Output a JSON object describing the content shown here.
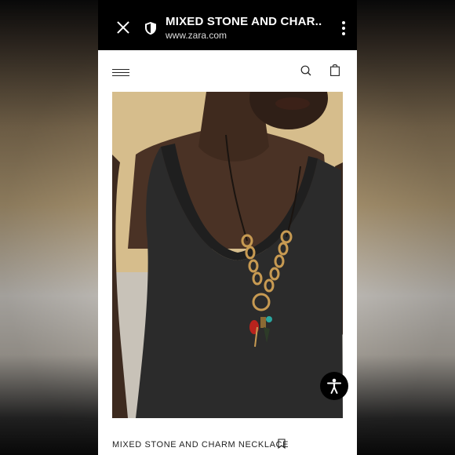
{
  "browser": {
    "title": "MIXED STONE AND CHAR...",
    "url": "www.zara.com"
  },
  "product": {
    "name": "MIXED STONE AND CHARM NECKLACE"
  },
  "icons": {
    "close": "close-icon",
    "shield": "shield-icon",
    "menu": "more-vert-icon",
    "hamburger": "hamburger-icon",
    "search": "search-icon",
    "bag": "shopping-bag-icon",
    "bookmark": "bookmark-icon",
    "accessibility": "accessibility-icon"
  },
  "colors": {
    "browser_bar": "#000000",
    "page_bg": "#ffffff",
    "text": "#222222"
  }
}
